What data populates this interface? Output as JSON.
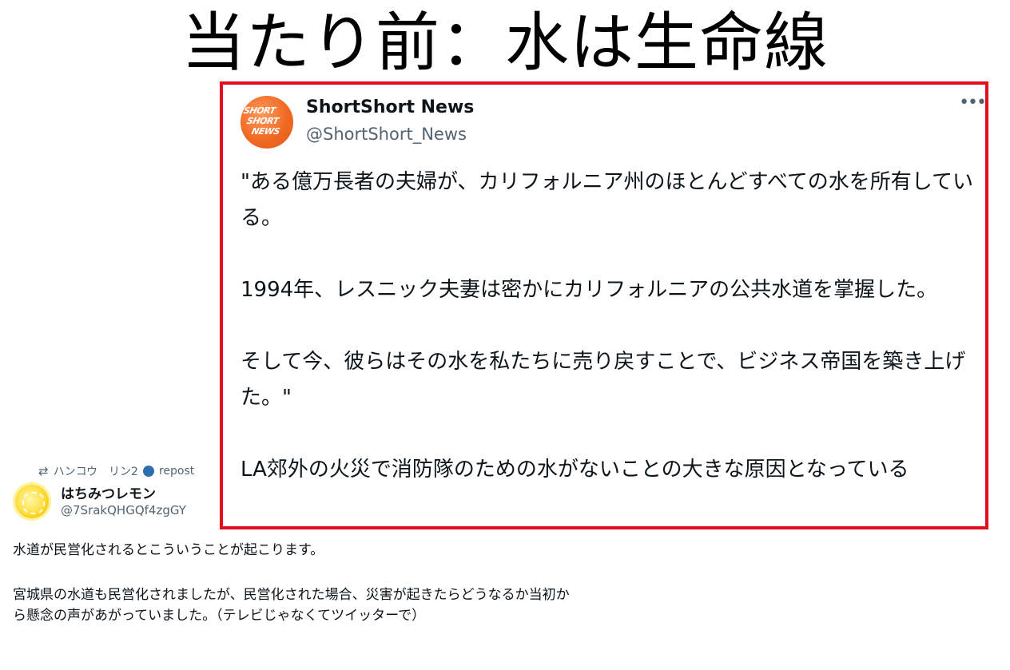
{
  "headline": "当たり前：水は生命線",
  "quoted_tweet": {
    "author_name": "ShortShort News",
    "author_handle": "@ShortShort_News",
    "avatar_logo_text": [
      "SHORT",
      "SHORT",
      "NEWS"
    ],
    "more_label": "•••",
    "paragraphs": [
      "\"ある億万長者の夫婦が、カリフォルニア州のほとんどすべての水を所有している。",
      "1994年、レスニック夫妻は密かにカリフォルニアの公共水道を掌握した。",
      "そして今、彼らはその水を私たちに売り戻すことで、ビジネス帝国を築き上げた。\"",
      "LA郊外の火災で消防隊のための水がないことの大きな原因となっている"
    ],
    "border_color": "#e0101c"
  },
  "background_tweet": {
    "repost_line": {
      "icon": "repost-icon",
      "reposter": "ハンコウ　リン2",
      "suffix": "repost"
    },
    "author_name": "はちみつレモン",
    "author_handle": "@7SrakQHGQf4zgGY",
    "paragraphs": [
      "水道が民営化されるとこういうことが起こります。",
      "宮城県の水道も民営化されましたが、民営化された場合、災害が起きたらどうなるか当初から懸念の声があがっていました。（テレビじゃなくてツイッターで）"
    ]
  }
}
